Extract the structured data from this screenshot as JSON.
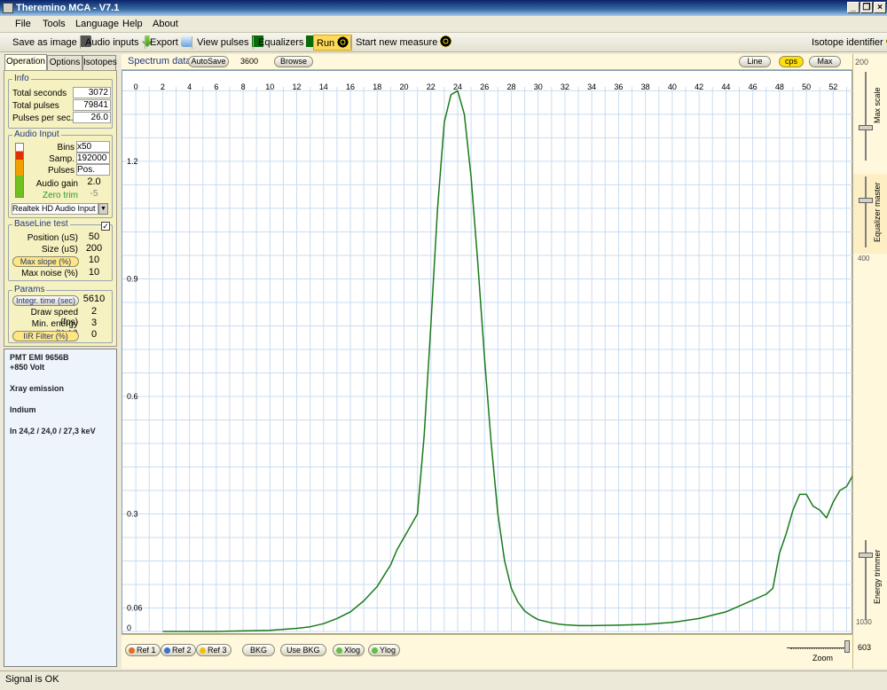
{
  "window": {
    "title": "Theremino MCA - V7.1"
  },
  "menu": [
    "File",
    "Tools",
    "Language",
    "Help",
    "About"
  ],
  "toolbar": {
    "save_image": "Save as image",
    "audio_inputs": "Audio inputs",
    "export": "Export",
    "view_pulses": "View pulses",
    "equalizers": "Equalizers",
    "run": "Run",
    "start_new": "Start new measure",
    "isotope": "Isotope identifier"
  },
  "tabs": [
    "Operation",
    "Options",
    "Isotopes"
  ],
  "info": {
    "title": "Info",
    "total_seconds_label": "Total seconds",
    "total_seconds": "3072",
    "total_pulses_label": "Total pulses",
    "total_pulses": "79841",
    "pps_label": "Pulses per sec.",
    "pps": "26.0"
  },
  "audio": {
    "title": "Audio Input",
    "bins_label": "Bins",
    "bins": "x50",
    "samp_label": "Samp.",
    "samp": "192000",
    "pulses_label": "Pulses",
    "pulses": "Pos.",
    "gain_label": "Audio gain",
    "gain": "2.0",
    "zero_label": "Zero trim",
    "zero": "-5",
    "device": "Realtek HD Audio Input"
  },
  "baseline": {
    "title": "BaseLine test",
    "position_label": "Position (uS)",
    "position": "50",
    "size_label": "Size (uS)",
    "size": "200",
    "maxslope_label": "Max slope (%)",
    "maxslope": "10",
    "maxnoise_label": "Max noise (%)",
    "maxnoise": "10"
  },
  "params": {
    "title": "Params",
    "integr_label": "Integr. time (sec)",
    "integr": "5610",
    "draw_label": "Draw speed (fps)",
    "draw": "2",
    "minen_label": "Min. energy (KeV)",
    "minen": "3",
    "iir_label": "IIR Filter (%)",
    "iir": "0"
  },
  "notes": {
    "line1": "PMT  EMI 9656B",
    "line2": "+850 Volt",
    "line3": "Xray emission",
    "line4": "Indium",
    "line5": "In 24,2 / 24,0 / 27,3 keV"
  },
  "spectrum": {
    "title": "Spectrum data",
    "autosave": "AutoSave",
    "interval": "3600",
    "browse": "Browse",
    "line": "Line",
    "cps": "cps",
    "max": "Max"
  },
  "right": {
    "top_value": "200",
    "max_scale": "Max scale",
    "equalizer": "Equalizer master",
    "eq_value": "400",
    "energy": "Energy trimmer",
    "energy_value": "1030",
    "zoom_value": "603"
  },
  "bottom": {
    "ref1": "Ref 1",
    "ref2": "Ref 2",
    "ref3": "Ref 3",
    "bkg": "BKG",
    "use_bkg": "Use BKG",
    "xlog": "Xlog",
    "ylog": "Ylog",
    "zoom": "Zoom"
  },
  "status": "Signal is OK",
  "colors": {
    "trace": "#1a7a1a",
    "grid": "#c8dcf0",
    "panel": "#f5f1c0"
  },
  "chart_data": {
    "type": "line",
    "xlim": [
      -1,
      53.5
    ],
    "ylim": [
      0,
      1.39
    ],
    "xticks": [
      "0",
      "2",
      "4",
      "6",
      "8",
      "10",
      "12",
      "14",
      "16",
      "18",
      "20",
      "22",
      "24",
      "26",
      "28",
      "30",
      "32",
      "34",
      "36",
      "38",
      "40",
      "42",
      "44",
      "46",
      "48",
      "50",
      "52"
    ],
    "yticks": [
      "0",
      "0.06",
      "0.3",
      "0.6",
      "0.9",
      "1.2"
    ],
    "series": [
      {
        "x": [
          2,
          6,
          10,
          12,
          13,
          14,
          15,
          16,
          17,
          18,
          19,
          19.5,
          20,
          20.5,
          21,
          21.5,
          22,
          22.5,
          23,
          23.5,
          24,
          24.5,
          25,
          25.5,
          26,
          26.5,
          27,
          27.5,
          28,
          28.5,
          29,
          29.5,
          30,
          30.5,
          31,
          31.5,
          32,
          32.5,
          33,
          34,
          36,
          38,
          40,
          42,
          44,
          45,
          46,
          47,
          47.5,
          48,
          48.5,
          49,
          49.5,
          50,
          50.5,
          51,
          51.5,
          52,
          52.5,
          53,
          53.5
        ],
        "y": [
          0,
          0,
          0.003,
          0.008,
          0.012,
          0.02,
          0.033,
          0.05,
          0.078,
          0.115,
          0.17,
          0.21,
          0.24,
          0.27,
          0.3,
          0.5,
          0.78,
          1.08,
          1.3,
          1.37,
          1.38,
          1.32,
          1.16,
          0.94,
          0.7,
          0.48,
          0.3,
          0.18,
          0.11,
          0.075,
          0.052,
          0.04,
          0.03,
          0.026,
          0.022,
          0.019,
          0.017,
          0.016,
          0.015,
          0.015,
          0.016,
          0.018,
          0.023,
          0.033,
          0.05,
          0.065,
          0.08,
          0.095,
          0.11,
          0.2,
          0.25,
          0.31,
          0.35,
          0.35,
          0.32,
          0.31,
          0.29,
          0.33,
          0.36,
          0.37,
          0.4
        ]
      }
    ]
  }
}
